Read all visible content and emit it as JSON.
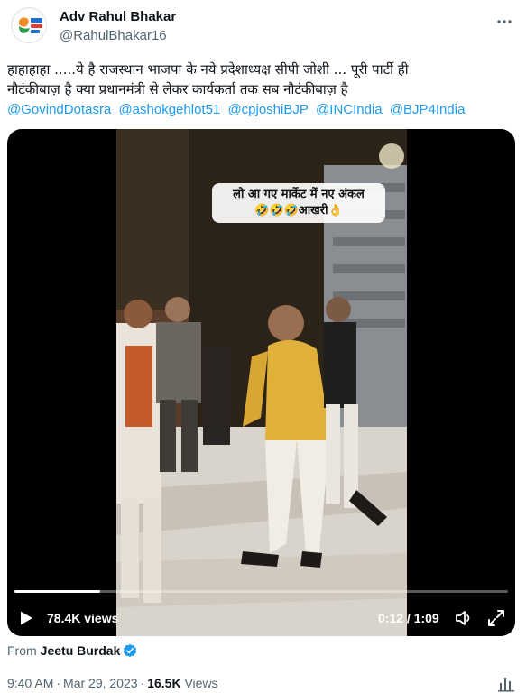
{
  "author": {
    "name": "Adv Rahul Bhakar",
    "handle": "@RahulBhakar16"
  },
  "tweet": {
    "line1": "हाहाहाहा .....ये है राजस्थान भाजपा के  नये प्रदेशाध्यक्ष सीपी जोशी ... पूरी पार्टी ही",
    "line2": "नौटंकीबाज़ है क्या प्रधानमंत्री से लेकर कार्यकर्ता तक सब नौटंकीबाज़ है",
    "mentions": [
      "@GovindDotasra",
      "@ashokgehlot51",
      "@cpjoshiBJP",
      "@INCIndia",
      "@BJP4India"
    ]
  },
  "video": {
    "overlay_line1": "लो आ गए मार्केट में नए अंकल",
    "overlay_line2": "🤣🤣🤣आखरी👌",
    "views": "78.4K views",
    "time": "0:12 / 1:09",
    "progress": 0.174
  },
  "source": {
    "from_label": "From",
    "name": "Jeetu Burdak"
  },
  "meta": {
    "time": "9:40 AM",
    "date": "Mar 29, 2023",
    "views_count": "16.5K",
    "views_label": "Views"
  },
  "colors": {
    "link": "#1d9bf0",
    "muted": "#536471",
    "verified": "#1d9bf0"
  },
  "icons": [
    "more-icon",
    "play-icon",
    "volume-icon",
    "fullscreen-icon",
    "verified-icon",
    "analytics-icon"
  ]
}
